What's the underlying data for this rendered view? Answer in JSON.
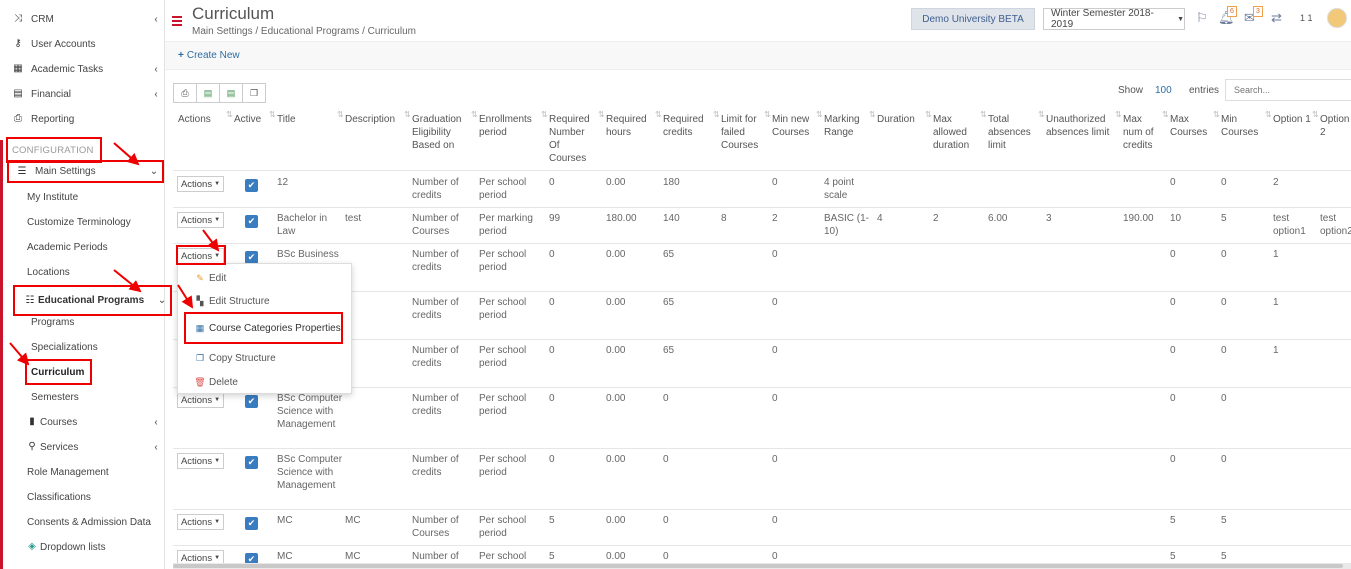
{
  "sidebar": {
    "items": [
      {
        "label": "CRM",
        "icon": "shuffle-icon",
        "chev": "‹"
      },
      {
        "label": "User Accounts",
        "icon": "key-icon",
        "chev": ""
      },
      {
        "label": "Academic Tasks",
        "icon": "grid-icon",
        "chev": "‹"
      },
      {
        "label": "Financial",
        "icon": "money-icon",
        "chev": "‹"
      },
      {
        "label": "Reporting",
        "icon": "print-icon",
        "chev": ""
      }
    ],
    "config_label": "CONFIGURATION",
    "main_settings": "Main Settings",
    "sub": {
      "my_institute": "My Institute",
      "customize_terminology": "Customize Terminology",
      "academic_periods": "Academic Periods",
      "locations": "Locations",
      "educational_programs": "Educational Programs",
      "programs": "Programs",
      "specializations": "Specializations",
      "curriculum": "Curriculum",
      "semesters": "Semesters",
      "courses": "Courses",
      "services": "Services",
      "role_management": "Role Management",
      "classifications": "Classifications",
      "consents": "Consents & Admission Data",
      "dropdown_lists": "Dropdown lists"
    }
  },
  "header": {
    "title": "Curriculum",
    "breadcrumb": "Main Settings  /  Educational Programs  /  Curriculum",
    "demo_button": "Demo University BETA",
    "semester": "Winter Semester 2018-2019",
    "badge_bell": "6",
    "badge_mail": "3",
    "user_num": "1 1"
  },
  "toolbar": {
    "create_new": "Create New",
    "show": "Show",
    "entries_value": "100",
    "entries": "entries",
    "search_placeholder": "Search..."
  },
  "table": {
    "headers": {
      "actions": "Actions",
      "active": "Active",
      "title": "Title",
      "description": "Description",
      "grad": "Graduation Eligibility Based on",
      "enroll": "Enrollments period",
      "req_num": "Required Number Of Courses",
      "req_hours": "Required hours",
      "req_credits": "Required credits",
      "limit": "Limit for failed Courses",
      "min_new": "Min new Courses",
      "marking": "Marking Range",
      "duration": "Duration",
      "max_dur": "Max allowed duration",
      "total_abs": "Total absences limit",
      "unauth_abs": "Unauthorized absences limit",
      "max_credits": "Max num of credits",
      "max_courses": "Max Courses",
      "min_courses": "Min Courses",
      "opt1": "Option 1",
      "opt2": "Option 2"
    },
    "action_label": "Actions",
    "rows": [
      {
        "title": "12",
        "description": "",
        "grad": "Number of credits",
        "enroll": "Per school period",
        "req_num": "0",
        "req_hours": "0.00",
        "req_credits": "180",
        "limit": "",
        "min_new": "0",
        "marking": "4 point scale",
        "duration": "",
        "max_dur": "",
        "total_abs": "",
        "unauth_abs": "",
        "max_credits": "",
        "max_courses": "0",
        "min_courses": "0",
        "opt1": "2",
        "opt2": ""
      },
      {
        "title": "Bachelor in Law",
        "description": "test",
        "grad": "Number of Courses",
        "enroll": "Per marking period",
        "req_num": "99",
        "req_hours": "180.00",
        "req_credits": "140",
        "limit": "8",
        "min_new": "2",
        "marking": "BASIC (1-10)",
        "duration": "4",
        "max_dur": "2",
        "total_abs": "6.00",
        "unauth_abs": "3",
        "max_credits": "190.00",
        "max_courses": "10",
        "min_courses": "5",
        "opt1": "test option1",
        "opt2": "test option2"
      },
      {
        "title": "BSc Business M...",
        "description": "",
        "grad": "Number of credits",
        "enroll": "Per school period",
        "req_num": "0",
        "req_hours": "0.00",
        "req_credits": "65",
        "limit": "",
        "min_new": "0",
        "marking": "",
        "duration": "",
        "max_dur": "",
        "total_abs": "",
        "unauth_abs": "",
        "max_credits": "",
        "max_courses": "0",
        "min_courses": "0",
        "opt1": "1",
        "opt2": ""
      },
      {
        "title": "",
        "description": "",
        "grad": "Number of credits",
        "enroll": "Per school period",
        "req_num": "0",
        "req_hours": "0.00",
        "req_credits": "65",
        "limit": "",
        "min_new": "0",
        "marking": "",
        "duration": "",
        "max_dur": "",
        "total_abs": "",
        "unauth_abs": "",
        "max_credits": "",
        "max_courses": "0",
        "min_courses": "0",
        "opt1": "1",
        "opt2": ""
      },
      {
        "title": "",
        "description": "",
        "grad": "Number of credits",
        "enroll": "Per school period",
        "req_num": "0",
        "req_hours": "0.00",
        "req_credits": "65",
        "limit": "",
        "min_new": "0",
        "marking": "",
        "duration": "",
        "max_dur": "",
        "total_abs": "",
        "unauth_abs": "",
        "max_credits": "",
        "max_courses": "0",
        "min_courses": "0",
        "opt1": "1",
        "opt2": ""
      },
      {
        "title": "BSc Computer Science with Management",
        "description": "",
        "grad": "Number of credits",
        "enroll": "Per school period",
        "req_num": "0",
        "req_hours": "0.00",
        "req_credits": "0",
        "limit": "",
        "min_new": "0",
        "marking": "",
        "duration": "",
        "max_dur": "",
        "total_abs": "",
        "unauth_abs": "",
        "max_credits": "",
        "max_courses": "0",
        "min_courses": "0",
        "opt1": "",
        "opt2": ""
      },
      {
        "title": "BSc Computer Science with Management",
        "description": "",
        "grad": "Number of credits",
        "enroll": "Per school period",
        "req_num": "0",
        "req_hours": "0.00",
        "req_credits": "0",
        "limit": "",
        "min_new": "0",
        "marking": "",
        "duration": "",
        "max_dur": "",
        "total_abs": "",
        "unauth_abs": "",
        "max_credits": "",
        "max_courses": "0",
        "min_courses": "0",
        "opt1": "",
        "opt2": ""
      },
      {
        "title": "MC",
        "description": "MC",
        "grad": "Number of Courses",
        "enroll": "Per school period",
        "req_num": "5",
        "req_hours": "0.00",
        "req_credits": "0",
        "limit": "",
        "min_new": "0",
        "marking": "",
        "duration": "",
        "max_dur": "",
        "total_abs": "",
        "unauth_abs": "",
        "max_credits": "",
        "max_courses": "5",
        "min_courses": "5",
        "opt1": "",
        "opt2": ""
      },
      {
        "title": "MC",
        "description": "MC",
        "grad": "Number of",
        "enroll": "Per school",
        "req_num": "5",
        "req_hours": "0.00",
        "req_credits": "0",
        "limit": "",
        "min_new": "0",
        "marking": "",
        "duration": "",
        "max_dur": "",
        "total_abs": "",
        "unauth_abs": "",
        "max_credits": "",
        "max_courses": "5",
        "min_courses": "5",
        "opt1": "",
        "opt2": ""
      }
    ]
  },
  "dropdown": {
    "edit": "Edit",
    "edit_structure": "Edit Structure",
    "course_categories": "Course Categories Properties",
    "copy_structure": "Copy Structure",
    "delete": "Delete"
  },
  "colors": {
    "accent": "#c9152c",
    "link": "#2e6da4",
    "checkbox": "#3a7cc0",
    "annotation": "#e00000"
  }
}
